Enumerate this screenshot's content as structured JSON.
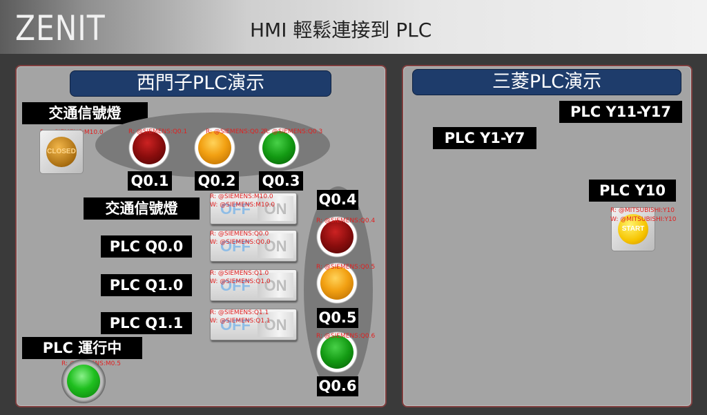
{
  "header": {
    "brand": "ZENIT",
    "title": "HMI 輕鬆連接到 PLC"
  },
  "siemens": {
    "title": "西門子PLC演示",
    "traffic_label": "交通信號燈",
    "traffic_button": {
      "tag": "R: @SIEMENS:M10.0",
      "cap": "CLOSED"
    },
    "top_lamps": [
      {
        "label": "Q0.1",
        "tag": "R: @SIEMENS:Q0.1"
      },
      {
        "label": "Q0.2",
        "tag": "R: @SIEMENS:Q0.2"
      },
      {
        "label": "Q0.3",
        "tag": "R: @SIEMENS:Q0.3"
      }
    ],
    "switches": [
      {
        "label": "交通信號燈",
        "tag_r": "R: @SIEMENS:M10.0",
        "tag_w": "W: @SIEMENS:M10.0",
        "off": "OFF",
        "on": "ON"
      },
      {
        "label": "PLC Q0.0",
        "tag_r": "R: @SIEMENS:Q0.0",
        "tag_w": "W: @SIEMENS:Q0.0",
        "off": "OFF",
        "on": "ON"
      },
      {
        "label": "PLC Q1.0",
        "tag_r": "R: @SIEMENS:Q1.0",
        "tag_w": "W: @SIEMENS:Q1.0",
        "off": "OFF",
        "on": "ON"
      },
      {
        "label": "PLC Q1.1",
        "tag_r": "R: @SIEMENS:Q1.1",
        "tag_w": "W: @SIEMENS:Q1.1",
        "off": "OFF",
        "on": "ON"
      }
    ],
    "side_lamps": [
      {
        "label": "Q0.4",
        "tag": "R: @SIEMENS:Q0.4"
      },
      {
        "label": "Q0.5",
        "tag": "R: @SIEMENS:Q0.5"
      },
      {
        "label": "Q0.6",
        "tag": "R: @SIEMENS:Q0.6"
      }
    ],
    "running": {
      "label": "PLC 運行中",
      "tag": "R: @SIEMENS:M0.5"
    }
  },
  "mitsubishi": {
    "title": "三菱PLC演示",
    "y11_label": "PLC Y11-Y17",
    "y1_label": "PLC Y1-Y7",
    "y10": {
      "label": "PLC Y10",
      "tag_r": "R: @MITSUBISHI:Y10",
      "tag_w": "W: @MITSUBISHI:Y10",
      "cap": "START"
    }
  },
  "colors": {
    "panel_title_bg": "#1e3c6b",
    "tag_text": "#e02020",
    "panel_bg": "#a4a4a4"
  }
}
